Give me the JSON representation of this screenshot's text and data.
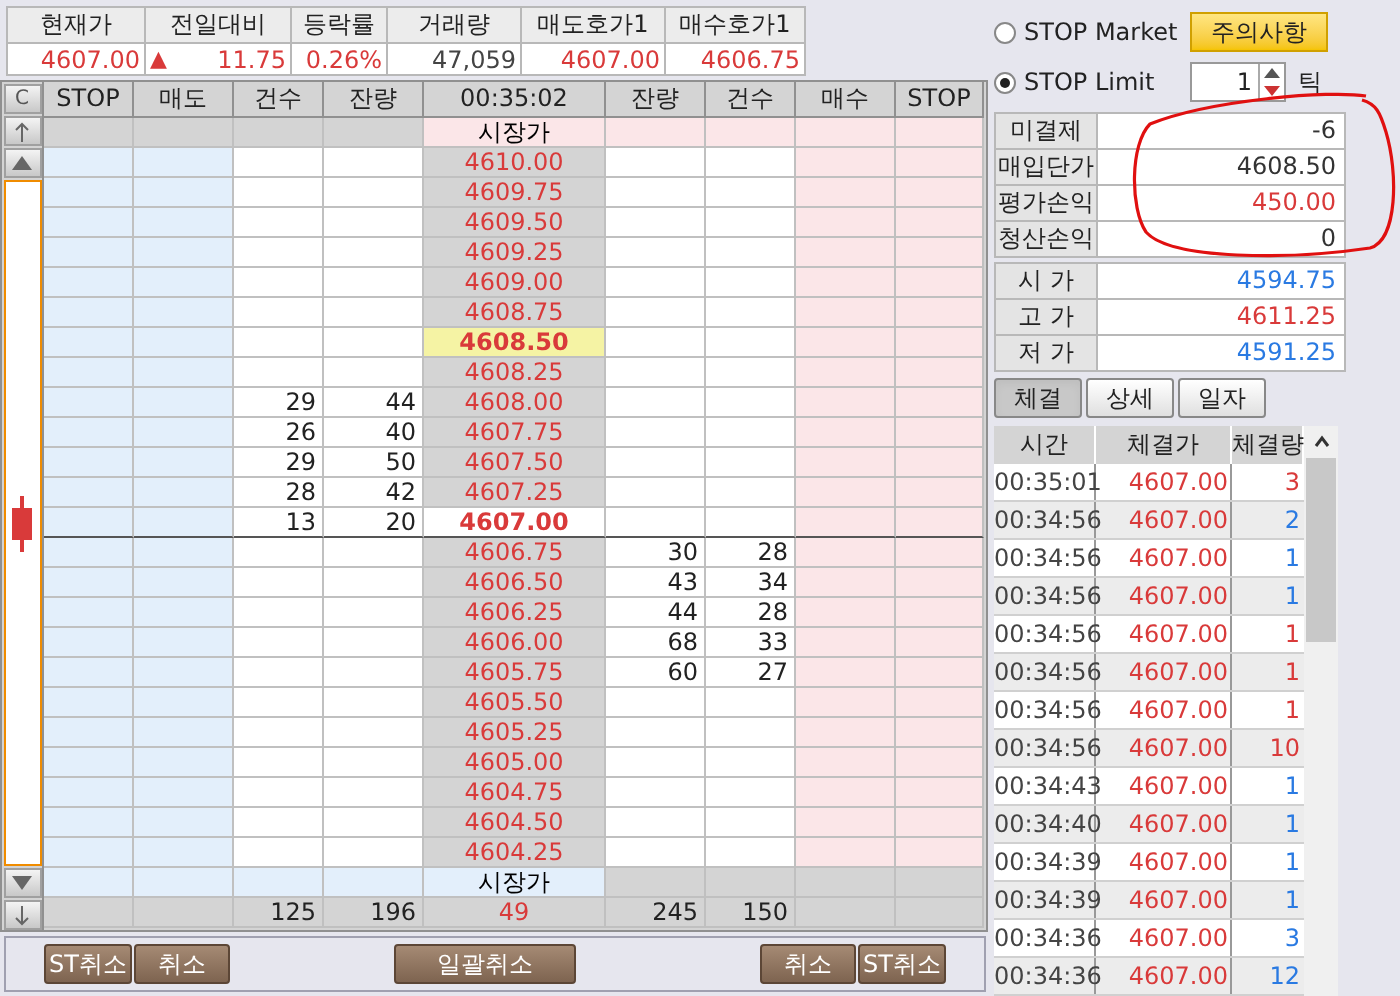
{
  "quote": {
    "columns": [
      "현재가",
      "전일대비",
      "등락률",
      "거래량",
      "매도호가1",
      "매수호가1"
    ],
    "values": [
      {
        "text": "4607.00",
        "color": "#d93a3a"
      },
      {
        "text": "11.75",
        "color": "#d93a3a",
        "arrow": "▲"
      },
      {
        "text": "0.26%",
        "color": "#d93a3a"
      },
      {
        "text": "47,059",
        "color": "#444444"
      },
      {
        "text": "4607.00",
        "color": "#d93a3a"
      },
      {
        "text": "4606.75",
        "color": "#d93a3a"
      }
    ]
  },
  "ladder": {
    "corner": "C",
    "time": "00:35:02",
    "columns": [
      "STOP",
      "매도",
      "건수",
      "잔량",
      "잔량",
      "건수",
      "매수",
      "STOP"
    ],
    "rows": [
      {
        "kind": "market_ask",
        "price": "시장가"
      },
      {
        "kind": "price",
        "price": "4610.00"
      },
      {
        "kind": "price",
        "price": "4609.75"
      },
      {
        "kind": "price",
        "price": "4609.50"
      },
      {
        "kind": "price",
        "price": "4609.25"
      },
      {
        "kind": "price",
        "price": "4609.00"
      },
      {
        "kind": "price",
        "price": "4608.75"
      },
      {
        "kind": "avg",
        "price": "4608.50"
      },
      {
        "kind": "price",
        "price": "4608.25"
      },
      {
        "kind": "price",
        "price": "4608.00",
        "ask_count": "29",
        "ask_qty": "44"
      },
      {
        "kind": "price",
        "price": "4607.75",
        "ask_count": "26",
        "ask_qty": "40"
      },
      {
        "kind": "price",
        "price": "4607.50",
        "ask_count": "29",
        "ask_qty": "50"
      },
      {
        "kind": "price",
        "price": "4607.25",
        "ask_count": "28",
        "ask_qty": "42"
      },
      {
        "kind": "current",
        "price": "4607.00",
        "ask_count": "13",
        "ask_qty": "20"
      },
      {
        "kind": "price",
        "price": "4606.75",
        "bid_qty": "30",
        "bid_count": "28"
      },
      {
        "kind": "price",
        "price": "4606.50",
        "bid_qty": "43",
        "bid_count": "34"
      },
      {
        "kind": "price",
        "price": "4606.25",
        "bid_qty": "44",
        "bid_count": "28"
      },
      {
        "kind": "price",
        "price": "4606.00",
        "bid_qty": "68",
        "bid_count": "33"
      },
      {
        "kind": "price",
        "price": "4605.75",
        "bid_qty": "60",
        "bid_count": "27"
      },
      {
        "kind": "price",
        "price": "4605.50"
      },
      {
        "kind": "price",
        "price": "4605.25"
      },
      {
        "kind": "price",
        "price": "4605.00"
      },
      {
        "kind": "price",
        "price": "4604.75"
      },
      {
        "kind": "price",
        "price": "4604.50"
      },
      {
        "kind": "price",
        "price": "4604.25"
      },
      {
        "kind": "market_bid",
        "price": "시장가"
      },
      {
        "kind": "total",
        "ask_count": "125",
        "ask_qty": "196",
        "price": "49",
        "bid_qty": "245",
        "bid_count": "150"
      }
    ]
  },
  "bottom_buttons": {
    "left": [
      "ST취소",
      "취소"
    ],
    "center": "일괄취소",
    "right": [
      "취소",
      "ST취소"
    ]
  },
  "stop_options": [
    {
      "label": "STOP Market",
      "selected": false
    },
    {
      "label": "STOP Limit",
      "selected": true
    }
  ],
  "notice_button": "주의사항",
  "tick": {
    "value": "1",
    "unit": "틱"
  },
  "position": [
    {
      "label": "미결제",
      "value": "-6",
      "color": "#333333"
    },
    {
      "label": "매입단가",
      "value": "4608.50",
      "color": "#333333"
    },
    {
      "label": "평가손익",
      "value": "450.00",
      "color": "#d93a3a"
    },
    {
      "label": "청산손익",
      "value": "0",
      "color": "#333333"
    }
  ],
  "prices": [
    {
      "label": "시 가",
      "value": "4594.75",
      "color": "#2a7ae2"
    },
    {
      "label": "고 가",
      "value": "4611.25",
      "color": "#d93a3a"
    },
    {
      "label": "저 가",
      "value": "4591.25",
      "color": "#2a7ae2"
    }
  ],
  "tabs": [
    {
      "label": "체결",
      "selected": true
    },
    {
      "label": "상세",
      "selected": false
    },
    {
      "label": "일자",
      "selected": false
    }
  ],
  "trades": {
    "columns": [
      "시간",
      "체결가",
      "체결량"
    ],
    "rows": [
      {
        "time": "00:35:01",
        "price": "4607.00",
        "qty": "3",
        "color": "#d93a3a"
      },
      {
        "time": "00:34:56",
        "price": "4607.00",
        "qty": "2",
        "color": "#2a7ae2"
      },
      {
        "time": "00:34:56",
        "price": "4607.00",
        "qty": "1",
        "color": "#2a7ae2"
      },
      {
        "time": "00:34:56",
        "price": "4607.00",
        "qty": "1",
        "color": "#2a7ae2"
      },
      {
        "time": "00:34:56",
        "price": "4607.00",
        "qty": "1",
        "color": "#d93a3a"
      },
      {
        "time": "00:34:56",
        "price": "4607.00",
        "qty": "1",
        "color": "#d93a3a"
      },
      {
        "time": "00:34:56",
        "price": "4607.00",
        "qty": "1",
        "color": "#d93a3a"
      },
      {
        "time": "00:34:56",
        "price": "4607.00",
        "qty": "10",
        "color": "#d93a3a"
      },
      {
        "time": "00:34:43",
        "price": "4607.00",
        "qty": "1",
        "color": "#2a7ae2"
      },
      {
        "time": "00:34:40",
        "price": "4607.00",
        "qty": "1",
        "color": "#2a7ae2"
      },
      {
        "time": "00:34:39",
        "price": "4607.00",
        "qty": "1",
        "color": "#2a7ae2"
      },
      {
        "time": "00:34:39",
        "price": "4607.00",
        "qty": "1",
        "color": "#2a7ae2"
      },
      {
        "time": "00:34:36",
        "price": "4607.00",
        "qty": "3",
        "color": "#2a7ae2"
      },
      {
        "time": "00:34:36",
        "price": "4607.00",
        "qty": "12",
        "color": "#2a7ae2"
      }
    ]
  }
}
